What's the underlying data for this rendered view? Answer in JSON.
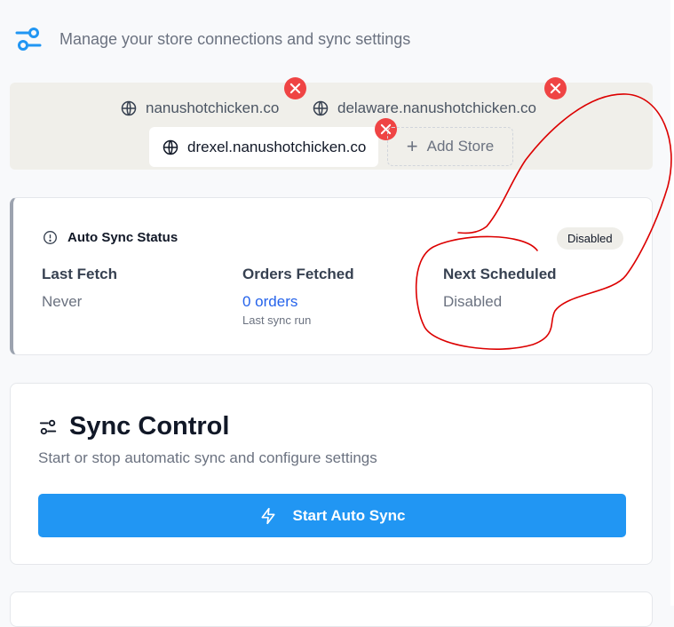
{
  "header": {
    "description": "Manage your store connections and sync settings",
    "icon": "sliders-icon"
  },
  "stores": {
    "items": [
      {
        "label": "nanushotchicken.co",
        "icon": "globe-icon",
        "active": false
      },
      {
        "label": "delaware.nanushotchicken.co",
        "icon": "globe-icon",
        "active": false
      },
      {
        "label": "drexel.nanushotchicken.co",
        "icon": "globe-icon",
        "active": true
      }
    ],
    "add_label": "Add Store",
    "close_icon": "x-icon"
  },
  "status": {
    "title": "Auto Sync Status",
    "badge": "Disabled",
    "last_fetch": {
      "label": "Last Fetch",
      "value": "Never"
    },
    "orders_fetched": {
      "label": "Orders Fetched",
      "value": "0 orders",
      "sub": "Last sync run"
    },
    "next_scheduled": {
      "label": "Next Scheduled",
      "value": "Disabled"
    }
  },
  "control": {
    "title": "Sync Control",
    "description": "Start or stop automatic sync and configure settings",
    "button_label": "Start Auto Sync"
  },
  "colors": {
    "accent": "#2196f3",
    "danger": "#ef4444",
    "link": "#2563eb",
    "annotation": "#dc0000"
  }
}
